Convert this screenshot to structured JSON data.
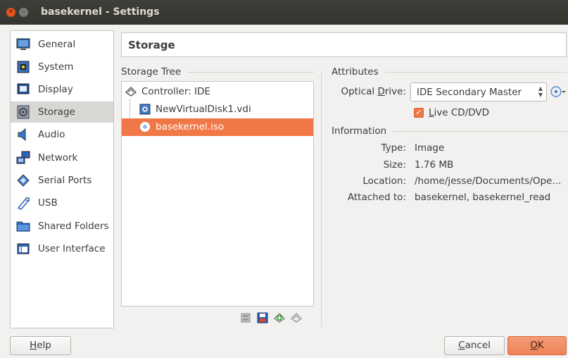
{
  "window": {
    "title": "basekernel - Settings"
  },
  "sidebar": {
    "items": [
      {
        "label": "General",
        "icon": "general-icon"
      },
      {
        "label": "System",
        "icon": "system-icon"
      },
      {
        "label": "Display",
        "icon": "display-icon"
      },
      {
        "label": "Storage",
        "icon": "storage-icon",
        "selected": true
      },
      {
        "label": "Audio",
        "icon": "audio-icon"
      },
      {
        "label": "Network",
        "icon": "network-icon"
      },
      {
        "label": "Serial Ports",
        "icon": "serial-ports-icon"
      },
      {
        "label": "USB",
        "icon": "usb-icon"
      },
      {
        "label": "Shared Folders",
        "icon": "shared-folders-icon"
      },
      {
        "label": "User Interface",
        "icon": "user-interface-icon"
      }
    ]
  },
  "main": {
    "title": "Storage",
    "storage_tree": {
      "label": "Storage Tree",
      "nodes": [
        {
          "label": "Controller: IDE",
          "icon": "controller-ide-icon"
        },
        {
          "label": "NewVirtualDisk1.vdi",
          "icon": "hard-disk-icon"
        },
        {
          "label": "basekernel.iso",
          "icon": "optical-disc-icon",
          "selected": true
        }
      ],
      "toolbar": [
        "controller-properties-icon",
        "save-icon",
        "add-attachment-icon",
        "remove-controller-icon"
      ]
    },
    "attributes": {
      "label": "Attributes",
      "optical_drive_prefix": "Optical ",
      "optical_drive_mnemonic": "D",
      "optical_drive_suffix": "rive:",
      "optical_drive_value": "IDE Secondary Master",
      "live_cd_checked": true,
      "live_cd_mnemonic": "L",
      "live_cd_suffix": "ive CD/DVD"
    },
    "information": {
      "label": "Information",
      "rows": [
        {
          "label": "Type:",
          "value": "Image"
        },
        {
          "label": "Size:",
          "value": "1.76 MB"
        },
        {
          "label": "Location:",
          "value": "/home/jesse/Documents/Ope..."
        },
        {
          "label": "Attached to:",
          "value": "basekernel, basekernel_read"
        }
      ]
    }
  },
  "buttons": {
    "help_mnemonic": "H",
    "help_suffix": "elp",
    "cancel_mnemonic": "C",
    "cancel_suffix": "ancel",
    "ok_mnemonic": "O",
    "ok_suffix": "K"
  },
  "colors": {
    "selection": "#f07746",
    "titlebar": "#3b3b37"
  }
}
